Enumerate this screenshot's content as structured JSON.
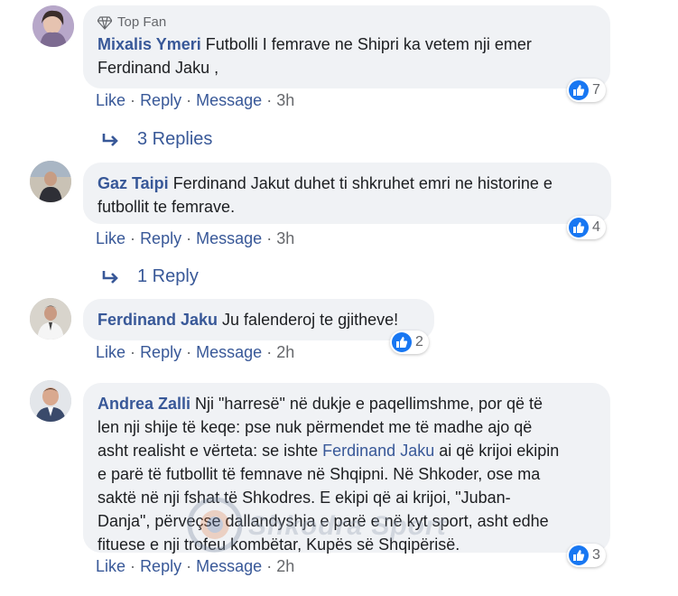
{
  "comments": [
    {
      "badge": "Top Fan",
      "author": "Mixalis Ymeri",
      "text_lines": [
        "Futbolli I femrave ne Shipri ka vetem nji emer",
        "Ferdinand Jaku ,"
      ],
      "reactions": "7",
      "actions": {
        "like": "Like",
        "reply": "Reply",
        "message": "Message",
        "time": "3h"
      },
      "replies": "3 Replies"
    },
    {
      "author": "Gaz Taipi",
      "text_lines": [
        "Ferdinand Jakut duhet ti shkruhet emri ne historine e",
        "futbollit te femrave."
      ],
      "reactions": "4",
      "actions": {
        "like": "Like",
        "reply": "Reply",
        "message": "Message",
        "time": "3h"
      },
      "replies": "1 Reply"
    },
    {
      "author": "Ferdinand Jaku",
      "text_lines": [
        "Ju falenderoj te gjitheve!"
      ],
      "reactions": "2",
      "actions": {
        "like": "Like",
        "reply": "Reply",
        "message": "Message",
        "time": "2h"
      }
    },
    {
      "author": "Andrea Zalli",
      "text_first": "Nji \"harresë\" në dukje e paqellimshme, por që të",
      "text_lines": [
        "len nji shije të keqe: pse nuk përmendet me të madhe ajo që",
        "asht realisht e vërteta: se ishte "
      ],
      "mention": "Ferdinand Jaku",
      "mention_after": " ai që krijoi ekipin",
      "text_rest": [
        "e parë të futbollit të femnave në Shqipni. Në Shkoder, ose ma",
        "saktë në nji fshat të Shkodres. E ekipi që ai krijoi, \"Juban-",
        "Danja\", përveçse dallandyshja e parë e në kyt sport, asht edhe",
        "fituese e nji trofeu kombëtar, Kupës së Shqipërisë."
      ],
      "reactions": "3",
      "actions": {
        "like": "Like",
        "reply": "Reply",
        "message": "Message",
        "time": "2h"
      }
    }
  ],
  "separator": "·",
  "watermark": "Shkodra Sport",
  "colors": {
    "link": "#385898",
    "bubble": "#f0f2f5",
    "like": "#1877f2",
    "muted": "#65676b"
  }
}
